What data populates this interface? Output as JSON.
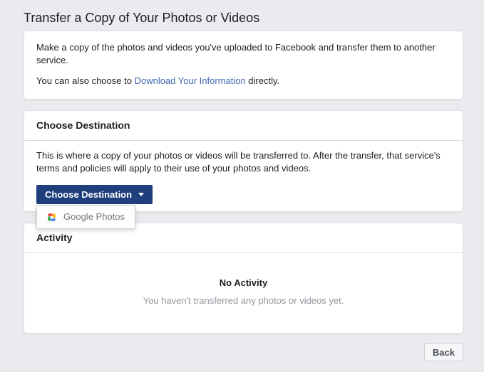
{
  "colors": {
    "page-bg": "#e9ebee",
    "accent-button": "#1f3e7c",
    "link": "#4267b2",
    "text": "#1c1e21",
    "muted-text": "#90949c"
  },
  "page": {
    "title": "Transfer a Copy of Your Photos or Videos"
  },
  "intro_card": {
    "paragraph1": "Make a copy of the photos and videos you've uploaded to Facebook and transfer them to another service.",
    "paragraph2_prefix": "You can also choose to ",
    "paragraph2_link": "Download Your Information",
    "paragraph2_suffix": " directly."
  },
  "destination_card": {
    "title": "Choose Destination",
    "description": "This is where a copy of your photos or videos will be transferred to. After the transfer, that service's terms and policies will apply to their use of your photos and videos.",
    "button_label": "Choose Destination",
    "dropdown": {
      "options": [
        {
          "label": "Google Photos",
          "icon": "google-photos-icon"
        }
      ]
    }
  },
  "activity_card": {
    "title": "Activity",
    "empty_title": "No Activity",
    "empty_subtitle": "You haven't transferred any photos or videos yet."
  },
  "footer": {
    "back_label": "Back"
  }
}
